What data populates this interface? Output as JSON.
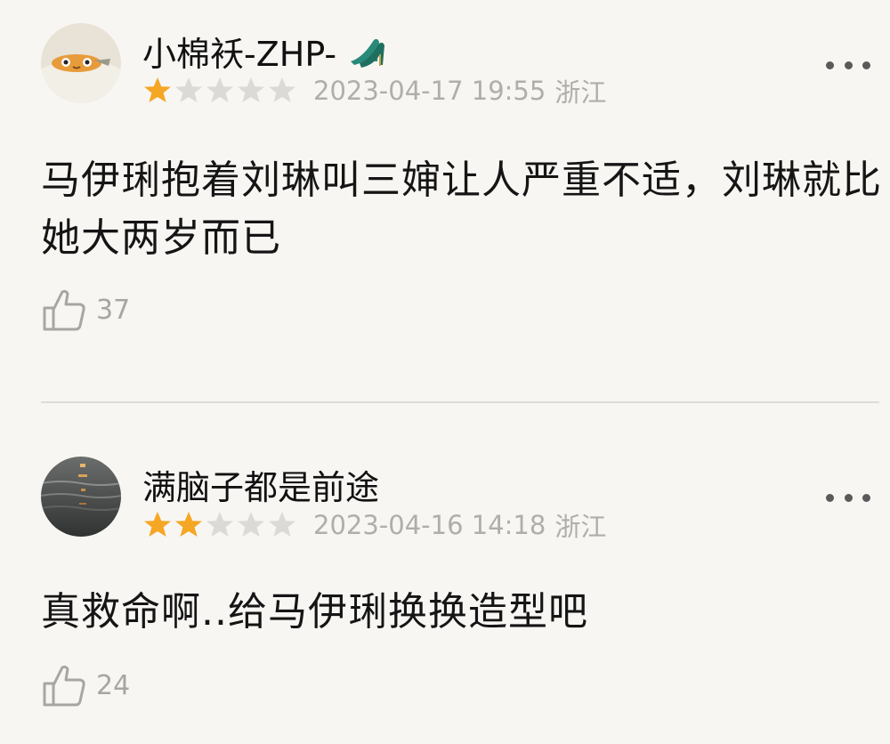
{
  "comments": [
    {
      "username": "小棉袄-ZHP-",
      "username_emoji": "high-heel-shoes-icon",
      "rating": 1,
      "max_rating": 5,
      "timestamp": "2023-04-17 19:55",
      "location": "浙江",
      "body_line1": "马伊琍抱着刘琳叫三婶让人严重不适，刘琳就比",
      "body_line2": "她大两岁而已",
      "likes": "37",
      "avatar_icon": "cartoon-face-avatar"
    },
    {
      "username": "满脑子都是前途",
      "rating": 2,
      "max_rating": 5,
      "timestamp": "2023-04-16 14:18",
      "location": "浙江",
      "body_line1": "真救命啊..给马伊琍换换造型吧",
      "likes": "24",
      "avatar_icon": "night-water-avatar"
    }
  ],
  "colors": {
    "background": "#f8f6f3",
    "star_filled": "#f5a623",
    "star_empty": "#dcdad6",
    "meta_text": "#b0aeab",
    "divider": "#dedcd8"
  }
}
